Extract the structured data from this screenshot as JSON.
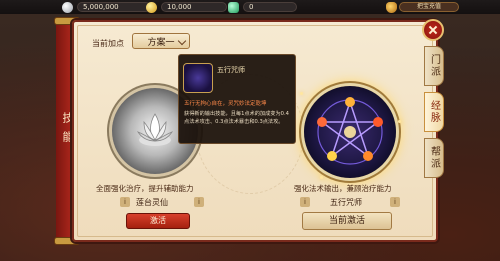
{
  "topbar": {
    "silver": "5,000,000",
    "gold": "10,000",
    "jade": "0",
    "recharge_label": "把宝充值"
  },
  "sidebar": {
    "title": "技能"
  },
  "header": {
    "current_points_label": "当前加点",
    "scheme_value": "方案一"
  },
  "tooltip": {
    "title": "五行咒师",
    "lead": "五行无拘心自在，灵咒妙法定乾坤",
    "body": "获得新的输出技能，且每1点术的加成变为0.4点法术攻击、0.3点法术暴击和0.3点法攻。"
  },
  "left_school": {
    "name": "莲台灵仙",
    "desc": "全面强化治疗，提升辅助能力",
    "button": "激活"
  },
  "right_school": {
    "name": "五行咒师",
    "desc": "强化法术输出，兼顾治疗能力",
    "button": "当前激活"
  },
  "tabs": [
    {
      "label": "门派",
      "active": false
    },
    {
      "label": "经脉",
      "active": true
    },
    {
      "label": "帮派",
      "active": false
    }
  ],
  "colors": {
    "accent_red": "#a4241a",
    "parchment": "#f6ead2",
    "gold_border": "#e8c070"
  }
}
